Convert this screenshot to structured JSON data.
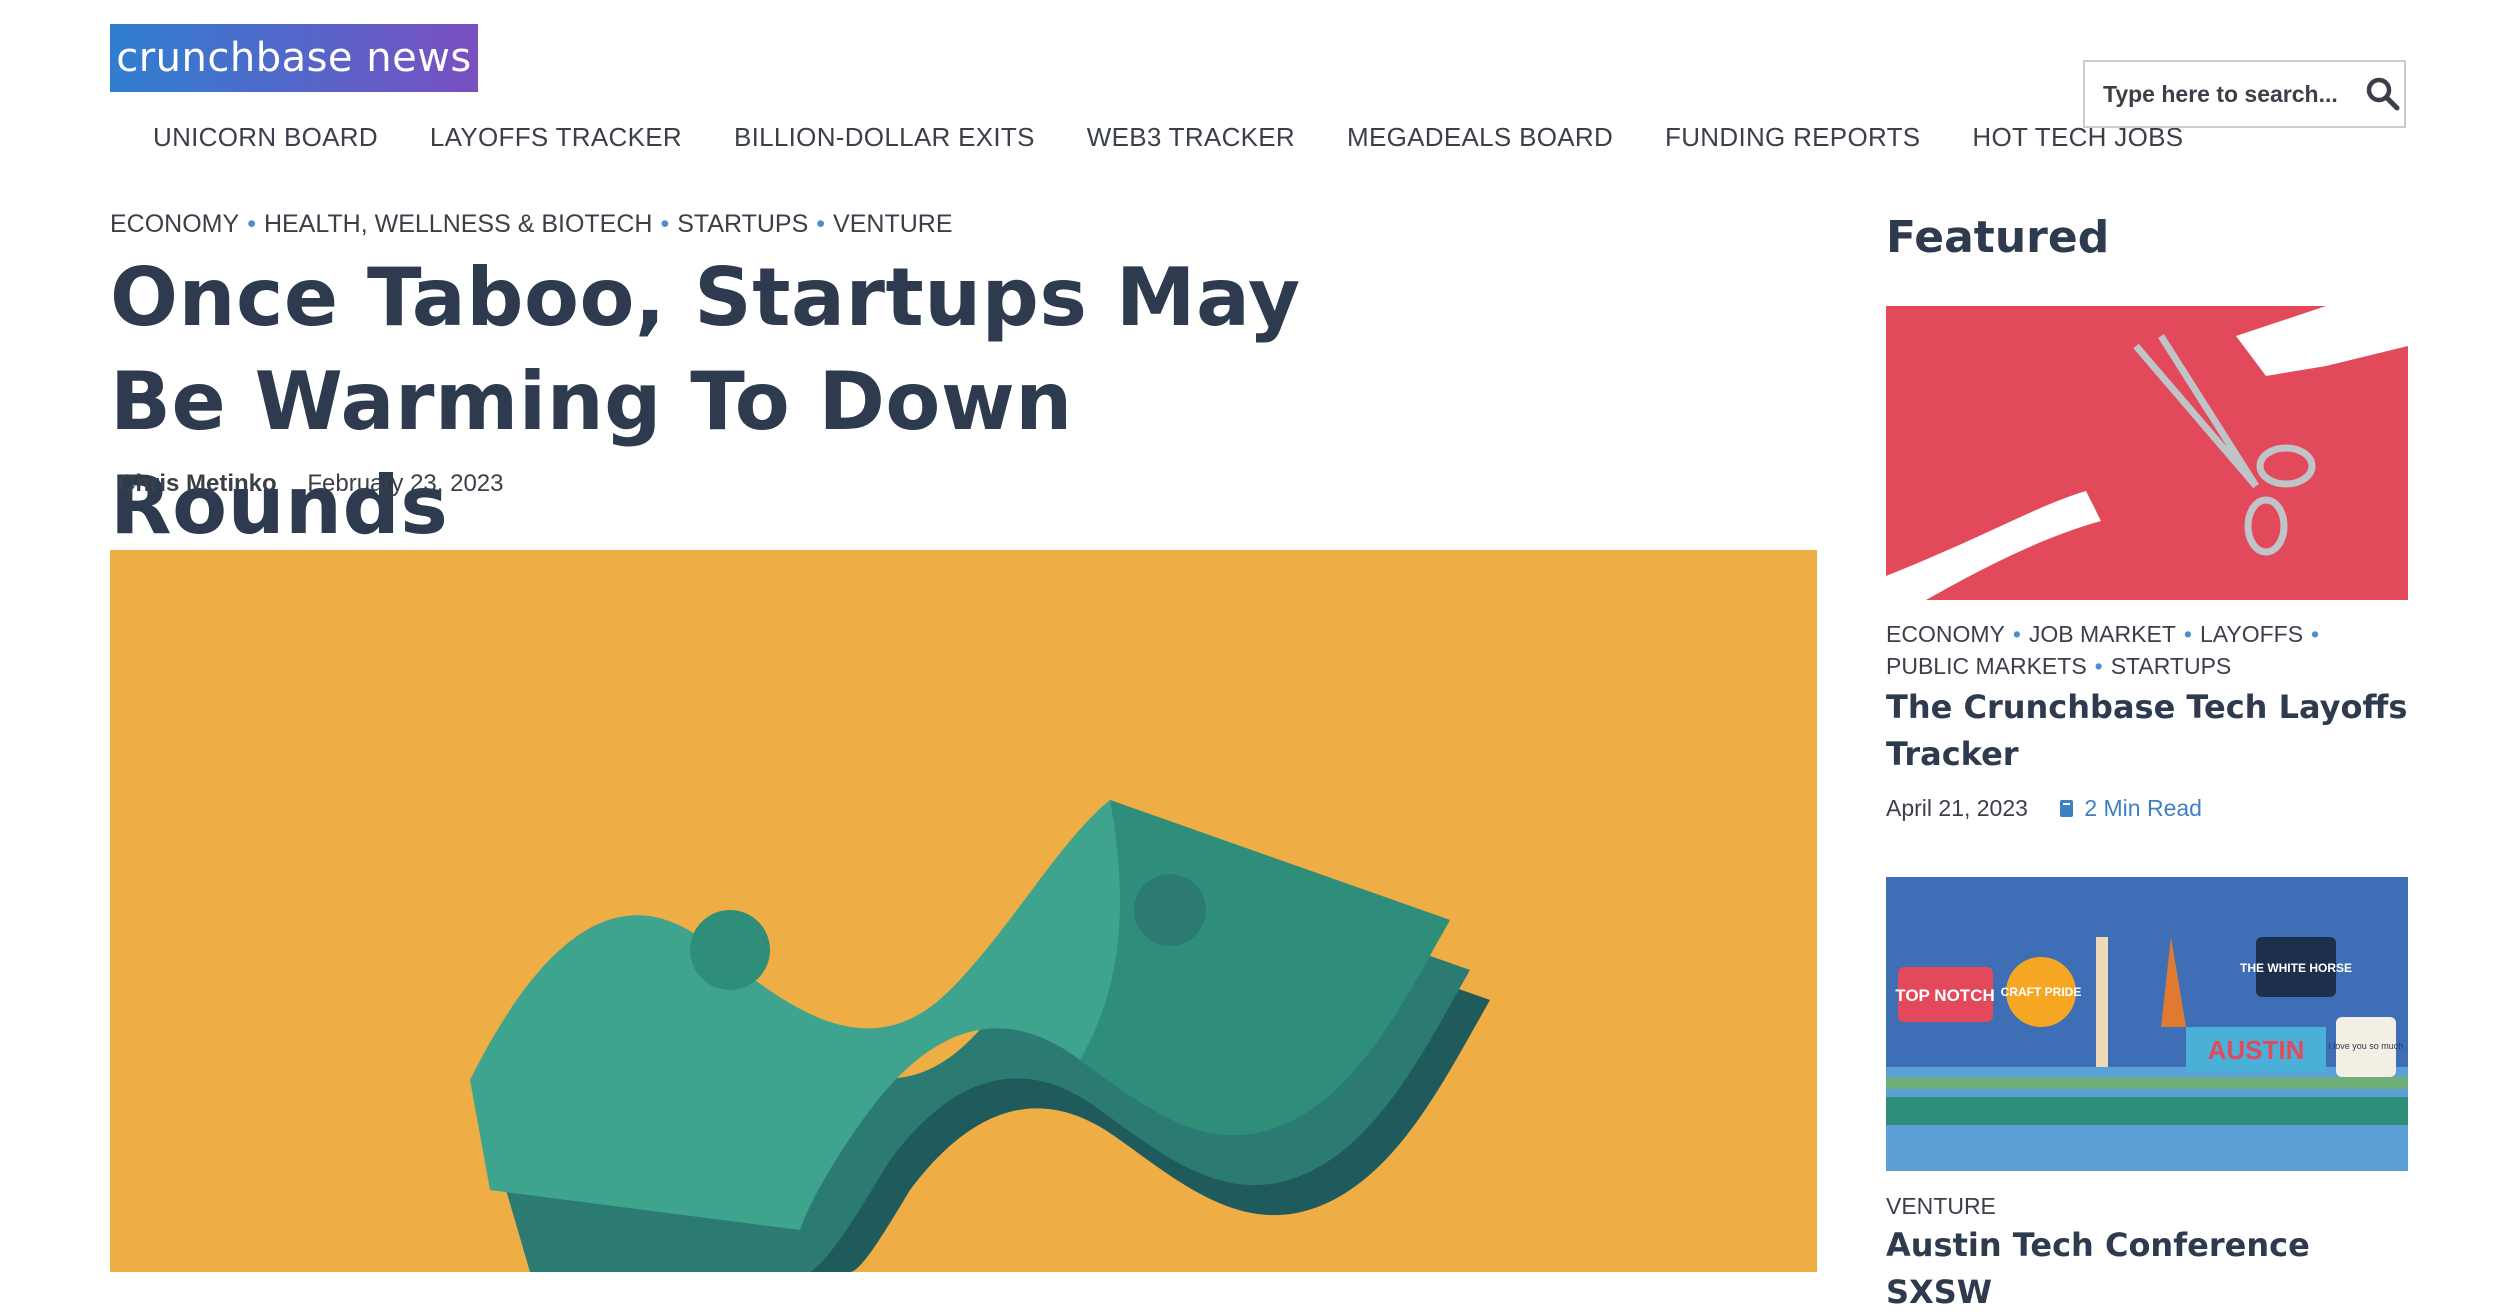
{
  "logo": "crunchbase news",
  "nav": [
    "UNICORN BOARD",
    "LAYOFFS TRACKER",
    "BILLION-DOLLAR EXITS",
    "WEB3 TRACKER",
    "MEGADEALS BOARD",
    "FUNDING REPORTS",
    "HOT TECH JOBS"
  ],
  "search": {
    "placeholder": "Type here to search..."
  },
  "article": {
    "categories": [
      "ECONOMY",
      "HEALTH, WELLNESS & BIOTECH",
      "STARTUPS",
      "VENTURE"
    ],
    "title": "Once Taboo, Startups May Be Warming To Down Rounds",
    "author": "Chris Metinko",
    "date": "February 23, 2023"
  },
  "featured": {
    "heading": "Featured",
    "cards": [
      {
        "categories": [
          "ECONOMY",
          "JOB MARKET",
          "LAYOFFS",
          "PUBLIC MARKETS",
          "STARTUPS"
        ],
        "title": "The Crunchbase Tech Layoffs Tracker",
        "date": "April 21, 2023",
        "read_time": "2 Min Read"
      },
      {
        "categories": [
          "VENTURE"
        ],
        "title": "Austin Tech Conference SXSW",
        "image_text": [
          "TOP NOTCH",
          "CRAFT PRIDE",
          "THE WHITE HORSE",
          "AUSTIN",
          "i love you so much"
        ]
      }
    ]
  },
  "colors": {
    "accent": "#4a8fd3",
    "heading": "#2e3a4d",
    "hero_bg": "#efad45",
    "money": "#3fa48e",
    "card1_bg": "#e24a5c"
  }
}
